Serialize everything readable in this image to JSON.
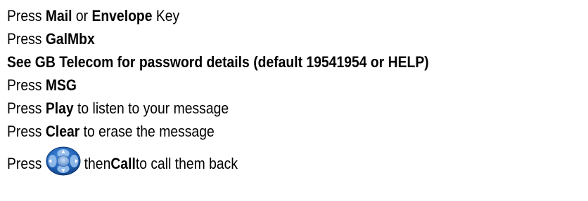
{
  "steps": [
    {
      "pre": "Press ",
      "bold": "Mail",
      "mid": " or ",
      "bold2": "Envelope",
      "post": " Key"
    },
    {
      "pre": "Press ",
      "bold": "GalMbx"
    },
    {
      "bold": "See GB Telecom for password details (default 19541954 or HELP)"
    },
    {
      "pre": "Press ",
      "bold": "MSG"
    },
    {
      "pre": "Press ",
      "bold": "Play",
      "post": " to listen to your message"
    },
    {
      "pre": "Press ",
      "bold": "Clear",
      "post": " to erase the message"
    },
    {
      "pre": "Press ",
      "mid": " then ",
      "bold": "Call",
      "post": " to call them back",
      "icon": "navigation-pad-icon"
    }
  ],
  "colors": {
    "text": "#000000",
    "navpad_body": "#1f63b8",
    "navpad_light": "#9ec4ef",
    "navpad_center": "#2a5ea8"
  }
}
